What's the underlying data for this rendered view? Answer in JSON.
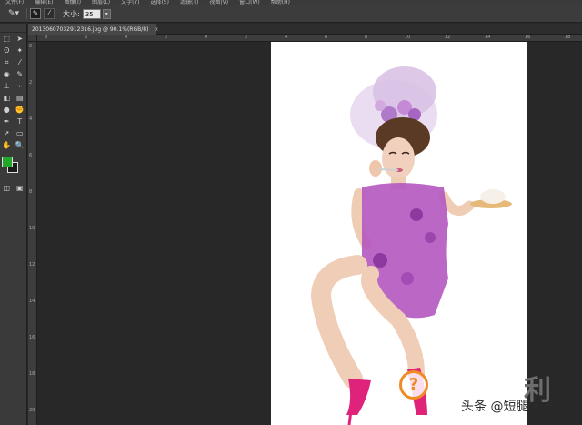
{
  "menu": [
    "文件(F)",
    "编辑(E)",
    "图像(I)",
    "图层(L)",
    "文字(Y)",
    "选择(S)",
    "滤镜(T)",
    "视图(V)",
    "窗口(W)",
    "帮助(H)"
  ],
  "options_bar": {
    "size_label": "大小:",
    "size_value": "35"
  },
  "document": {
    "tab_title": "20130607032912316.jpg @ 90.1%(RGB/8)",
    "close_glyph": "×"
  },
  "ruler_top_labels": [
    "8",
    "6",
    "4",
    "2",
    "0",
    "2",
    "4",
    "6",
    "8",
    "10",
    "12",
    "14",
    "16",
    "18",
    "20"
  ],
  "ruler_left_labels": [
    "0",
    "2",
    "4",
    "6",
    "8",
    "10",
    "12",
    "14",
    "16",
    "18",
    "20"
  ],
  "colors": {
    "foreground": "#21a82b",
    "background": "#1b1b1b",
    "dress": "#b45ac0",
    "shoes": "#e0237a"
  },
  "watermark": {
    "icon_glyph": "?",
    "text": "头条 @短腿大王",
    "side_char": "利"
  }
}
